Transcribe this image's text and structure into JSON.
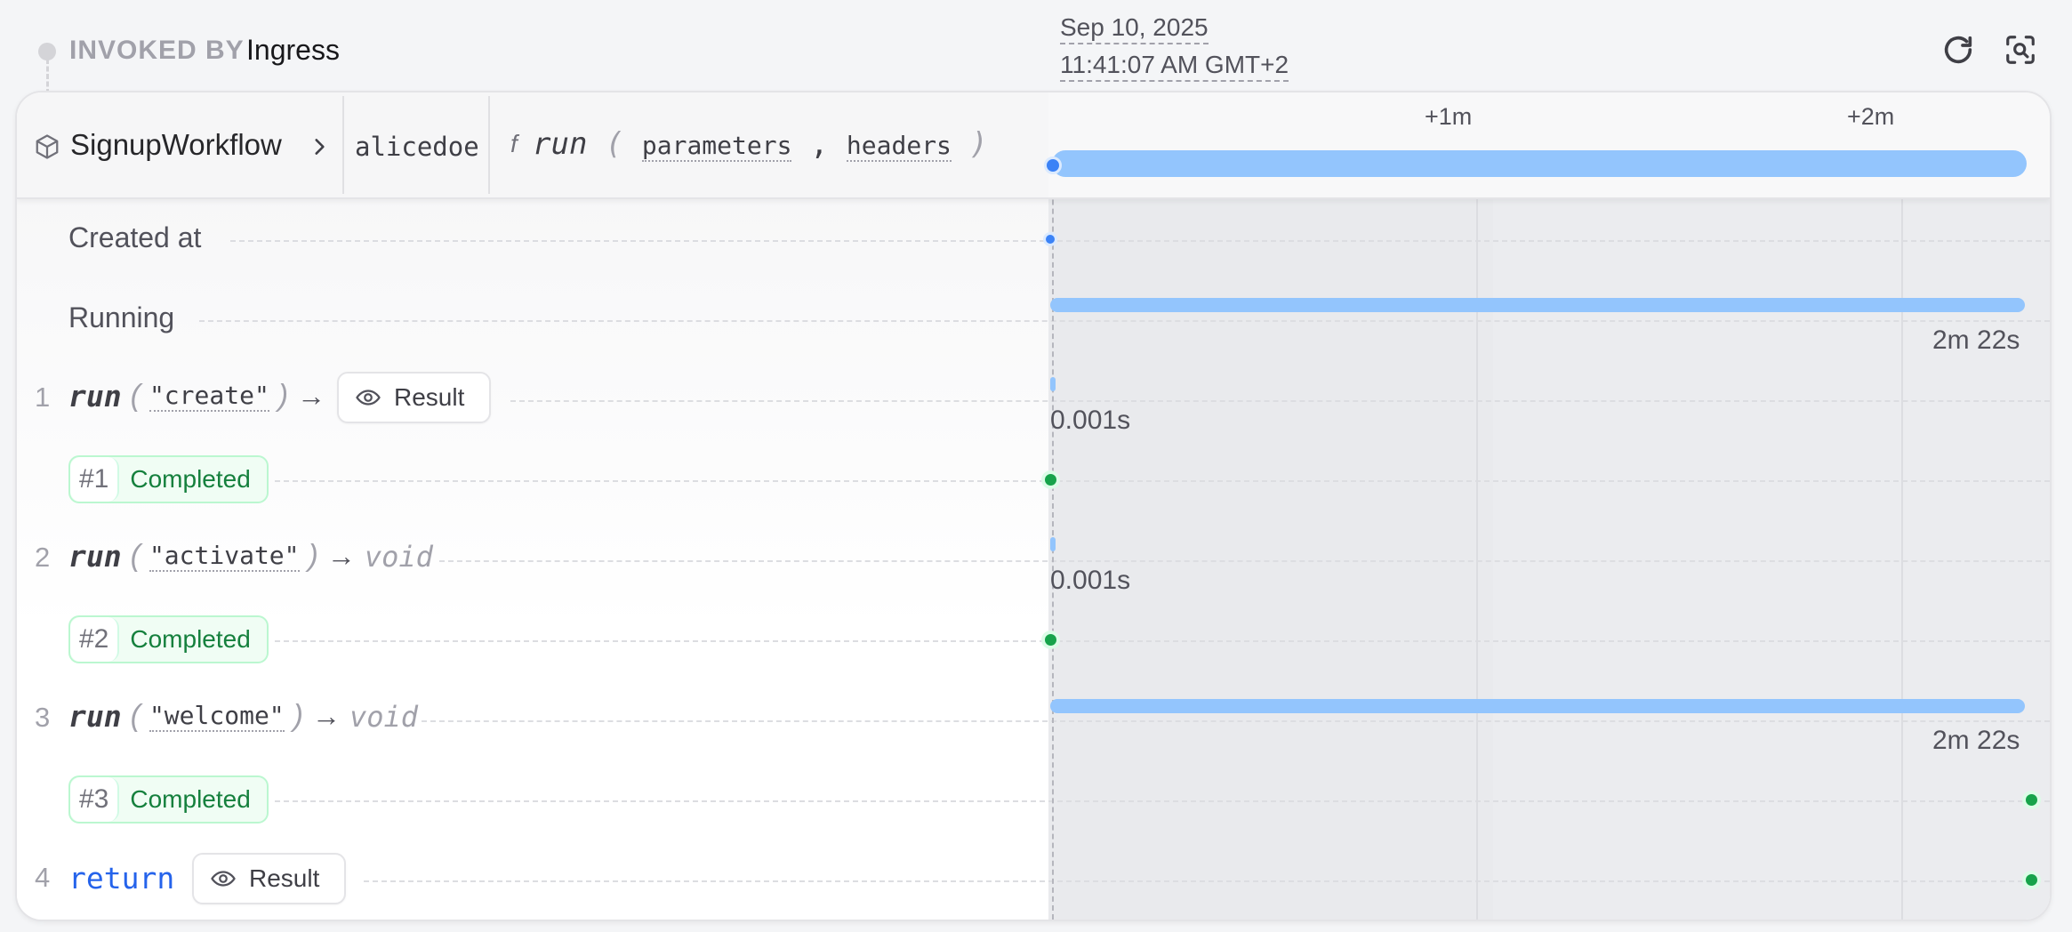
{
  "invoked": {
    "label": "INVOKED BY",
    "value": "Ingress"
  },
  "timestamp": {
    "date": "Sep 10, 2025",
    "time": "11:41:07 AM GMT+2"
  },
  "toolbar": {
    "refresh_icon": "refresh-icon",
    "inspect_icon": "scan-search-icon"
  },
  "header": {
    "workflow_icon": "cube-icon",
    "workflow": "SignupWorkflow",
    "key": "alicedoe",
    "fn_glyph": "f",
    "fn_name": "run",
    "open_paren": "(",
    "param1": "parameters",
    "comma": ",",
    "param2": "headers",
    "close_paren": ")",
    "ticks": [
      "+1m",
      "+2m"
    ]
  },
  "rows": {
    "created": {
      "label": "Created at"
    },
    "running": {
      "label": "Running",
      "duration": "2m 22s"
    },
    "step1": {
      "num": "1",
      "call": "run",
      "open": "(",
      "arg": "\"create\"",
      "close": ")",
      "arrow": "→",
      "result": "Result",
      "duration": "0.001s",
      "attempt": "#1",
      "status": "Completed"
    },
    "step2": {
      "num": "2",
      "call": "run",
      "open": "(",
      "arg": "\"activate\"",
      "close": ")",
      "arrow": "→",
      "ret": "void",
      "duration": "0.001s",
      "attempt": "#2",
      "status": "Completed"
    },
    "step3": {
      "num": "3",
      "call": "run",
      "open": "(",
      "arg": "\"welcome\"",
      "close": ")",
      "arrow": "→",
      "ret": "void",
      "duration": "2m 22s",
      "attempt": "#3",
      "status": "Completed"
    },
    "step4": {
      "num": "4",
      "keyword": "return",
      "result": "Result"
    }
  },
  "colors": {
    "bar": "#93c5fd",
    "success": "#16a34a",
    "accent": "#2563eb"
  }
}
